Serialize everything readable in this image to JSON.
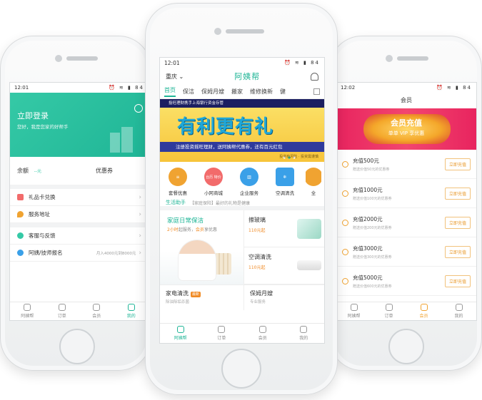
{
  "left": {
    "status": {
      "time": "12:01",
      "battery": "84"
    },
    "login": {
      "title": "立即登录",
      "subtitle": "您好，我是您家的好帮手"
    },
    "balance": {
      "label": "余额",
      "unit": "--元",
      "coupon_label": "优惠券"
    },
    "menu": [
      {
        "label": "礼品卡兑换",
        "color": "#f26b6b"
      },
      {
        "label": "服务地址",
        "color": "#f0a331"
      }
    ],
    "menu2": [
      {
        "label": "客服与反馈",
        "color": "#35c9a6"
      },
      {
        "label": "阿姨/技师报名",
        "hint": "月入4000元到8000元",
        "color": "#3aa0e8"
      }
    ],
    "tabs": [
      "阿姨帮",
      "订单",
      "会员",
      "我的"
    ]
  },
  "center": {
    "status": {
      "time": "12:01",
      "battery": "84"
    },
    "city": "重庆",
    "brand": "阿姨帮",
    "tabs": [
      "首页",
      "保洁",
      "保姆月嫂",
      "搬家",
      "维修换新",
      "健"
    ],
    "banner": {
      "top": "投旺理财携手上海银行资金存管",
      "headline": "有利更有礼",
      "strip": "注册投资摇旺理财，送阿姨帮代惠券，还有百元红包",
      "foot": "投资有风险 · 投资需谨慎"
    },
    "services": [
      {
        "label": "套餐优惠",
        "color": "#f0a331",
        "icon_text": ""
      },
      {
        "label": "小阿商城",
        "color": "#f26b6b",
        "icon_text": "台历 特价"
      },
      {
        "label": "企业服务",
        "color": "#3aa0e8",
        "icon_text": ""
      },
      {
        "label": "空调清洗",
        "color": "#3aa0e8",
        "icon_text": ""
      },
      {
        "label": "全",
        "color": "#f0a331",
        "icon_text": ""
      }
    ],
    "assistant": {
      "label": "生活助手",
      "tip": "【家庭保险】最好的礼物是健康"
    },
    "cards": {
      "clean_title": "家庭日常保洁",
      "clean_sub_a": "2小时",
      "clean_sub_b": "起服务，",
      "clean_sub_c": "会员",
      "clean_sub_d": "享优惠",
      "glass_title": "擦玻璃",
      "glass_price": "110元起",
      "ac_title": "空调清洗",
      "ac_price": "110元起",
      "appliance_title": "家电清洗",
      "appliance_tag": "最新",
      "appliance_sub": "除油除垢杀菌",
      "nanny_title": "保姆月嫂",
      "nanny_sub": "专业服务"
    },
    "tabbar": [
      "阿姨帮",
      "订单",
      "会员",
      "我的"
    ]
  },
  "right": {
    "status": {
      "time": "12:02",
      "battery": "84"
    },
    "title": "会员",
    "banner": {
      "headline": "会员充值",
      "sub": "单单 VIP 享优惠"
    },
    "recharges": [
      {
        "amount": "充值500元",
        "gift": "赠送价值50元的优惠券",
        "button": "立即充值"
      },
      {
        "amount": "充值1000元",
        "gift": "赠送价值100元的优惠券",
        "button": "立即充值"
      },
      {
        "amount": "充值2000元",
        "gift": "赠送价值200元的优惠券",
        "button": "立即充值"
      },
      {
        "amount": "充值3000元",
        "gift": "赠送价值300元的优惠券",
        "button": "立即充值"
      },
      {
        "amount": "充值5000元",
        "gift": "赠送价值600元的优惠券",
        "button": "立即充值"
      }
    ],
    "tabs": [
      "阿姨帮",
      "订单",
      "会员",
      "我的"
    ]
  }
}
